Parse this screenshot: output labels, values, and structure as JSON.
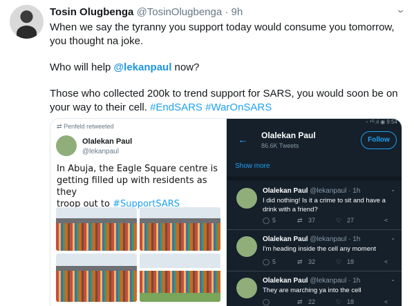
{
  "tweet": {
    "name": "Tosin Olugbenga",
    "meta": "@TosinOlugbenga · 9h",
    "line1": "When we say the tyranny you support today would consume you tomorrow,",
    "line2": "you thought na joke.",
    "question_before": "Who will help ",
    "question_mention": "@lekanpaul",
    "question_after": " now?",
    "line3": "Those who collected 200k to trend support for SARS, you would soon be on",
    "line4_before": "your way to their cell. ",
    "hashtag1": "#EndSARS",
    "hashtag2": "#WarOnSARS"
  },
  "left_card": {
    "retweet_label": "Penfeld retweeted",
    "name": "Olalekan Paul",
    "handle": "@lekanpaul",
    "line1": "In Abuja, the Eagle Square centre is",
    "line2": "getting filled up with residents as they",
    "line3_before": "troop out to ",
    "hashtag": "#SupportSARS"
  },
  "right_card": {
    "status_bar": "▫ ⁴ᴳ.ıl ◉ 9:54",
    "name": "Olalekan Paul",
    "tweet_count": "86.6K Tweets",
    "follow_label": "Follow",
    "show_more": "Show more",
    "tweets": [
      {
        "name": "Olalekan Paul",
        "meta": "@lekanpaul · 1h",
        "text": "I did nothing! Is it a crime to sit and have a drink with a friend?",
        "replies": "5",
        "retweets": "37",
        "likes": "27"
      },
      {
        "name": "Olalekan Paul",
        "meta": "@lekanpaul · 1h",
        "text": "I'm heading inside the cell any moment",
        "replies": "5",
        "retweets": "32",
        "likes": "18"
      },
      {
        "name": "Olalekan Paul",
        "meta": "@lekanpaul · 1h",
        "text": "They are marching ya into the cell",
        "replies": "",
        "retweets": "22",
        "likes": "18"
      }
    ]
  },
  "icons": {
    "caret": "chevron-down-icon",
    "retweet": "retweet-icon",
    "back": "back-arrow-icon",
    "reply": "reply-icon",
    "like": "heart-icon",
    "share": "share-icon"
  },
  "colors": {
    "accent": "#1da1f2",
    "dark_bg": "#15202b",
    "muted": "#657786"
  }
}
